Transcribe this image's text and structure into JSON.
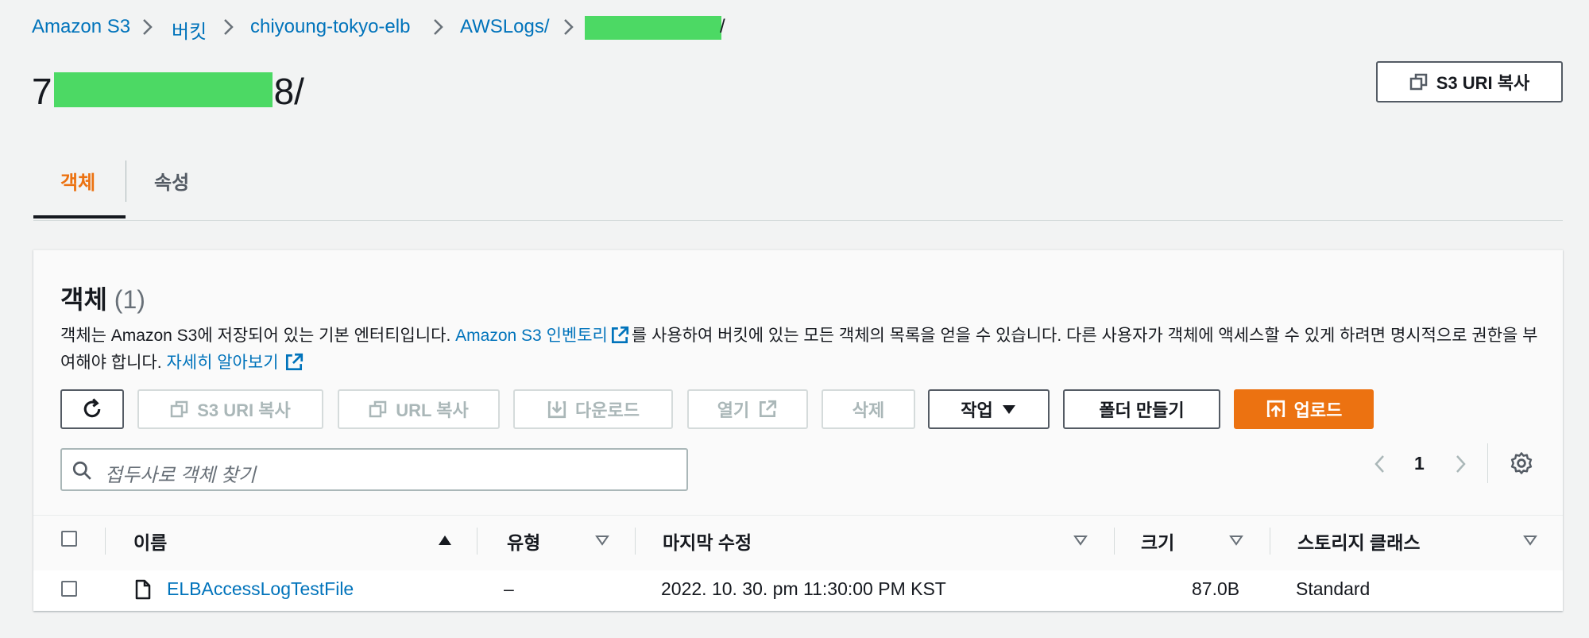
{
  "breadcrumb": {
    "items": [
      "Amazon S3",
      "버킷",
      "chiyoung-tokyo-elb",
      "AWSLogs/"
    ],
    "last_suffix": "/"
  },
  "page": {
    "title_prefix": "7",
    "title_suffix": "8/",
    "copy_uri_label": "S3 URI 복사"
  },
  "tabs": [
    {
      "label": "객체",
      "active": true
    },
    {
      "label": "속성",
      "active": false
    }
  ],
  "objects": {
    "title": "객체",
    "count": "(1)",
    "description_part1": "객체는 Amazon S3에 저장되어 있는 기본 엔터티입니다. ",
    "description_link1": "Amazon S3 인벤토리",
    "description_part2": "를 사용하여 버킷에 있는 모든 객체의 목록을 얻을 수 있습니다. 다른 사용자가 객체에 액세스할 수 있게 하려면 명시적으로 권한을 부여해야 합니다. ",
    "description_link2": "자세히 알아보기"
  },
  "toolbar": {
    "copy_s3_uri": "S3 URI 복사",
    "copy_url": "URL 복사",
    "download": "다운로드",
    "open": "열기",
    "delete": "삭제",
    "actions": "작업",
    "create_folder": "폴더 만들기",
    "upload": "업로드"
  },
  "search": {
    "placeholder": "접두사로 객체 찾기"
  },
  "pagination": {
    "current_page": "1"
  },
  "table": {
    "columns": [
      "이름",
      "유형",
      "마지막 수정",
      "크기",
      "스토리지 클래스"
    ],
    "rows": [
      {
        "name": "ELBAccessLogTestFile",
        "type": "–",
        "last_modified": "2022. 10. 30. pm 11:30:00 PM KST",
        "size": "87.0B",
        "storage_class": "Standard"
      }
    ]
  },
  "colors": {
    "link": "#0073bb",
    "primary": "#ec7211",
    "redaction": "#4cd964"
  }
}
